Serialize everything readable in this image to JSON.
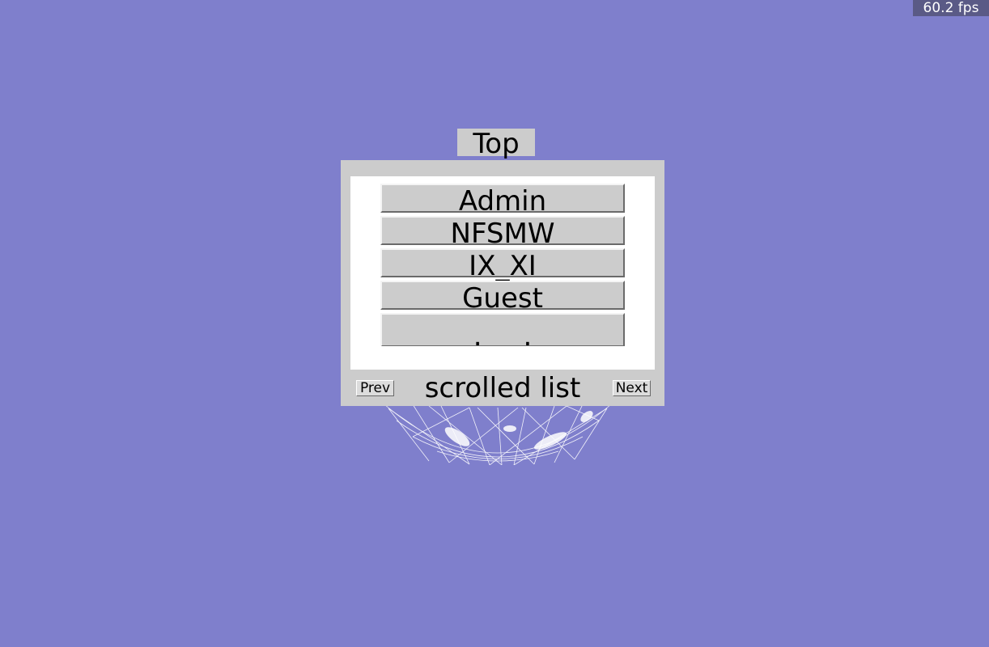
{
  "hud": {
    "fps": "60.2 fps"
  },
  "top_button": {
    "label": "Top"
  },
  "scroll_list": {
    "title": "scrolled list",
    "prev_label": "Prev",
    "next_label": "Next",
    "items": [
      {
        "label": "Admin"
      },
      {
        "label": "NFSMW"
      },
      {
        "label": "IX_XI"
      },
      {
        "label": "Guest"
      },
      {
        "label": ".___."
      }
    ]
  },
  "colors": {
    "background": "#7f7fcc",
    "panel": "#cccccc",
    "list_background": "#ffffff",
    "fps_badge": "#5a5a86"
  }
}
